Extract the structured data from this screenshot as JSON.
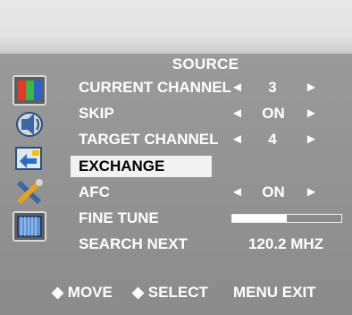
{
  "menu": {
    "title": "SOURCE",
    "rows": [
      {
        "label": "CURRENT CHANNEL",
        "value": "3"
      },
      {
        "label": "SKIP",
        "value": "ON"
      },
      {
        "label": "TARGET CHANNEL",
        "value": "4"
      },
      {
        "label": "EXCHANGE",
        "value": ""
      },
      {
        "label": "AFC",
        "value": "ON"
      },
      {
        "label": "FINE TUNE",
        "value": ""
      },
      {
        "label": "SEARCH NEXT",
        "value": "120.2 MHZ"
      }
    ],
    "fine_tune_level": 0.5,
    "left_arrow": "◄",
    "right_arrow": "►"
  },
  "footer": {
    "move": "◆ MOVE",
    "select": "◆ SELECT",
    "menu_exit": "MENU EXIT"
  },
  "sidebar_icons": [
    "color-bars-icon",
    "sound-icon",
    "channel-icon",
    "tools-icon",
    "screen-icon"
  ],
  "colors": {
    "background": "#8b8b8b",
    "highlight": "#f2f2f2",
    "text": "#ffffff"
  }
}
